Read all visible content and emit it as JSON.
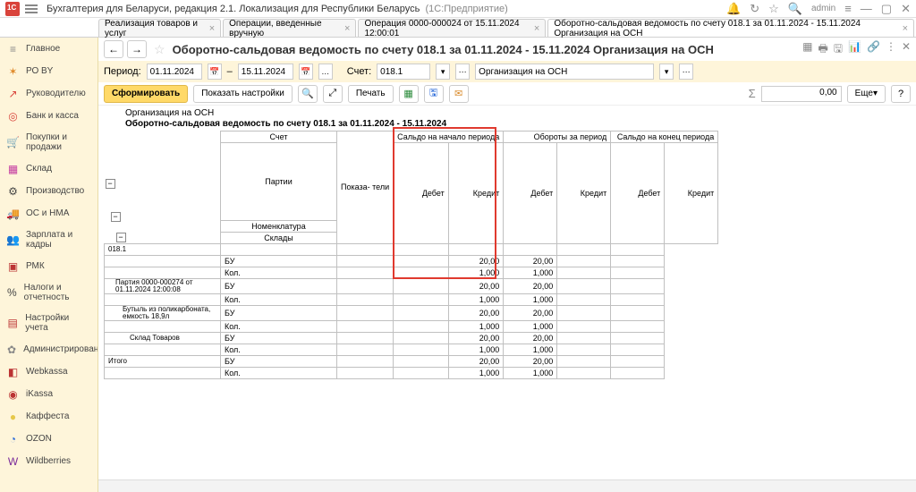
{
  "app": {
    "title": "Бухгалтерия для Беларуси, редакция 2.1. Локализация для Республики Беларусь",
    "suffix": "(1С:Предприятие)",
    "user": "admin"
  },
  "tabs": [
    {
      "label": "Реализация товаров и услуг"
    },
    {
      "label": "Операции, введенные вручную"
    },
    {
      "label": "Операция 0000-000024 от 15.11.2024 12:00:01"
    },
    {
      "label": "Оборотно-сальдовая ведомость по счету 018.1 за 01.11.2024 - 15.11.2024 Организация на ОСН",
      "active": true
    }
  ],
  "sidebar": [
    {
      "icon": "≡",
      "label": "Главное",
      "color": "#888"
    },
    {
      "icon": "✶",
      "label": "РО BY",
      "color": "#e08a2a"
    },
    {
      "icon": "↗",
      "label": "Руководителю",
      "color": "#d9433b"
    },
    {
      "icon": "◎",
      "label": "Банк и касса",
      "color": "#d9433b"
    },
    {
      "icon": "🛒",
      "label": "Покупки и продажи",
      "color": "#444"
    },
    {
      "icon": "▦",
      "label": "Склад",
      "color": "#c43aa0"
    },
    {
      "icon": "⚙",
      "label": "Производство",
      "color": "#444"
    },
    {
      "icon": "🚚",
      "label": "ОС и НМА",
      "color": "#444"
    },
    {
      "icon": "👥",
      "label": "Зарплата и кадры",
      "color": "#444"
    },
    {
      "icon": "▣",
      "label": "РМК",
      "color": "#b33"
    },
    {
      "icon": "%",
      "label": "Налоги и отчетность",
      "color": "#444"
    },
    {
      "icon": "▤",
      "label": "Настройки учета",
      "color": "#b33"
    },
    {
      "icon": "✿",
      "label": "Администрирование",
      "color": "#888"
    },
    {
      "icon": "◧",
      "label": "Webkassa",
      "color": "#b33"
    },
    {
      "icon": "◉",
      "label": "iKassa",
      "color": "#b33"
    },
    {
      "icon": "●",
      "label": "Каффеста",
      "color": "#e6c84a"
    },
    {
      "icon": "◔",
      "label": "OZON",
      "color": "#2a6ad9"
    },
    {
      "icon": "W",
      "label": "Wildberries",
      "color": "#7a2a9a"
    }
  ],
  "page": {
    "heading": "Оборотно-сальдовая ведомость по счету 018.1 за 01.11.2024 - 15.11.2024 Организация на ОСН"
  },
  "params": {
    "period_label": "Период:",
    "from": "01.11.2024",
    "to": "15.11.2024",
    "account_label": "Счет:",
    "account": "018.1",
    "org": "Организация на ОСН"
  },
  "toolbar": {
    "generate": "Сформировать",
    "show_settings": "Показать настройки",
    "print": "Печать",
    "more": "Еще",
    "sum_value": "0,00"
  },
  "report": {
    "org": "Организация на ОСН",
    "title": "Оборотно-сальдовая ведомость по счету 018.1 за 01.11.2024 - 15.11.2024",
    "headers": {
      "account": "Счет",
      "parties": "Партии",
      "nomen": "Номенклатура",
      "warehouses": "Склады",
      "indicators": "Показа-\nтели",
      "start": "Сальдо на начало периода",
      "turn": "Обороты за период",
      "end": "Сальдо на конец периода",
      "debit": "Дебет",
      "credit": "Кредит",
      "total": "Итого"
    },
    "rows": [
      {
        "lbl": "018.1",
        "i": 0
      },
      {
        "lbl": "",
        "i": 1,
        "ind": "БУ",
        "d": "20,00",
        "c": "20,00"
      },
      {
        "lbl": "",
        "i": 1,
        "ind": "Кол.",
        "d": "1,000",
        "c": "1,000"
      },
      {
        "lbl": "Партия 0000-000274 от 01.11.2024 12:00:08",
        "i": 1,
        "ind": "БУ",
        "d": "20,00",
        "c": "20,00"
      },
      {
        "lbl": "",
        "i": 1,
        "ind": "Кол.",
        "d": "1,000",
        "c": "1,000"
      },
      {
        "lbl": "Бутыль из поликарбоната, емкость 18,9л",
        "i": 2,
        "ind": "БУ",
        "d": "20,00",
        "c": "20,00"
      },
      {
        "lbl": "",
        "i": 2,
        "ind": "Кол.",
        "d": "1,000",
        "c": "1,000"
      },
      {
        "lbl": "Склад Товаров",
        "i": 3,
        "ind": "БУ",
        "d": "20,00",
        "c": "20,00"
      },
      {
        "lbl": "",
        "i": 3,
        "ind": "Кол.",
        "d": "1,000",
        "c": "1,000"
      },
      {
        "lbl": "Итого",
        "i": 0,
        "ind": "БУ",
        "d": "20,00",
        "c": "20,00",
        "total": true
      },
      {
        "lbl": "",
        "i": 0,
        "ind": "Кол.",
        "d": "1,000",
        "c": "1,000",
        "total": true
      }
    ]
  }
}
